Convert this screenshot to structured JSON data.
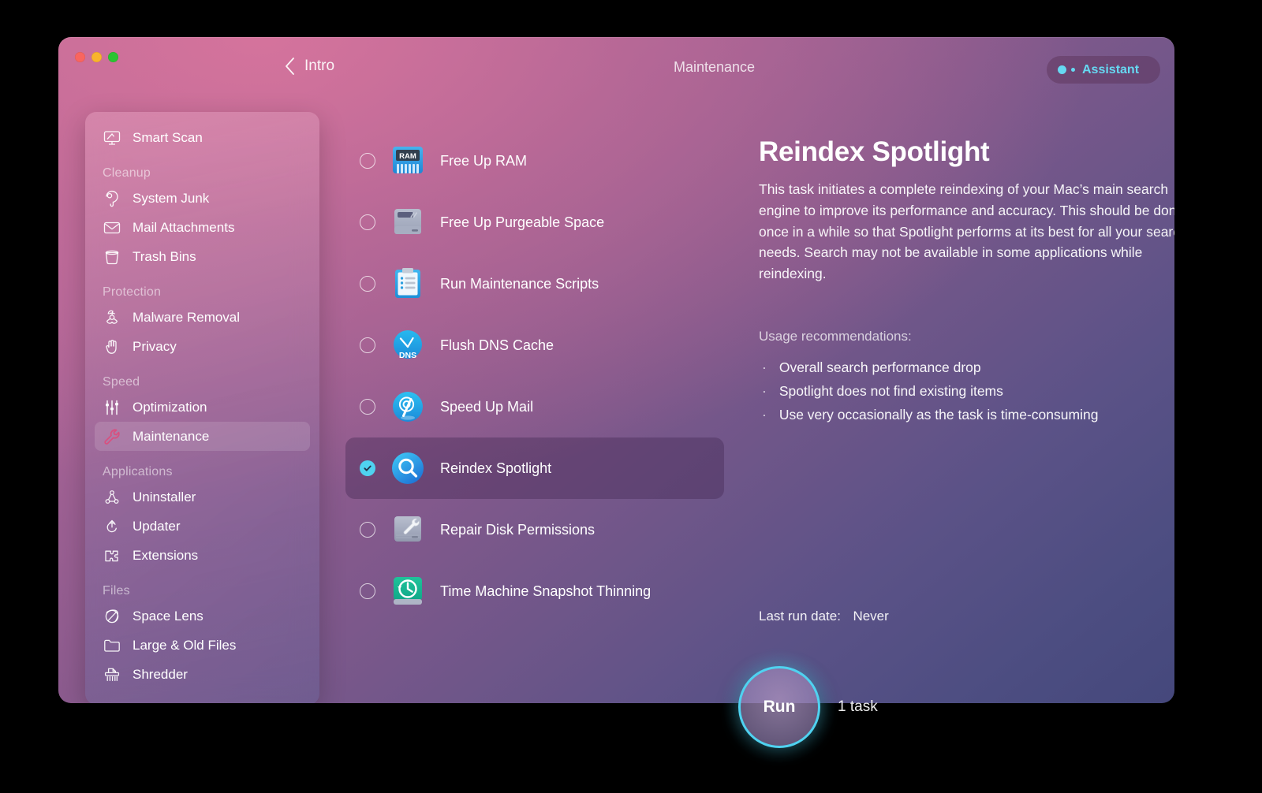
{
  "window": {
    "traffic_lights": [
      "close",
      "minimize",
      "zoom"
    ],
    "colors": {
      "accent_cyan": "#4fd2f0",
      "gradient_start": "#c46d97",
      "gradient_end": "#45487c",
      "selected_row": "rgba(68,41,83,0.40)"
    }
  },
  "topbar": {
    "back_label": "Intro",
    "breadcrumb_title": "Maintenance",
    "assistant_label": "Assistant"
  },
  "sidebar": {
    "groups": [
      {
        "title": "",
        "items": [
          {
            "label": "Smart Scan",
            "icon": "smart-scan-icon",
            "active": false
          }
        ]
      },
      {
        "title": "Cleanup",
        "items": [
          {
            "label": "System Junk",
            "icon": "system-junk-icon",
            "active": false
          },
          {
            "label": "Mail Attachments",
            "icon": "mail-icon",
            "active": false
          },
          {
            "label": "Trash Bins",
            "icon": "trash-bin-icon",
            "active": false
          }
        ]
      },
      {
        "title": "Protection",
        "items": [
          {
            "label": "Malware Removal",
            "icon": "biohazard-icon",
            "active": false
          },
          {
            "label": "Privacy",
            "icon": "hand-icon",
            "active": false
          }
        ]
      },
      {
        "title": "Speed",
        "items": [
          {
            "label": "Optimization",
            "icon": "sliders-icon",
            "active": false
          },
          {
            "label": "Maintenance",
            "icon": "wrench-icon",
            "active": true
          }
        ]
      },
      {
        "title": "Applications",
        "items": [
          {
            "label": "Uninstaller",
            "icon": "uninstaller-icon",
            "active": false
          },
          {
            "label": "Updater",
            "icon": "updater-icon",
            "active": false
          },
          {
            "label": "Extensions",
            "icon": "puzzle-icon",
            "active": false
          }
        ]
      },
      {
        "title": "Files",
        "items": [
          {
            "label": "Space Lens",
            "icon": "space-lens-icon",
            "active": false
          },
          {
            "label": "Large & Old Files",
            "icon": "folder-icon",
            "active": false
          },
          {
            "label": "Shredder",
            "icon": "shredder-icon",
            "active": false
          }
        ]
      }
    ]
  },
  "tasks": [
    {
      "label": "Free Up RAM",
      "icon": "ram-chip-icon",
      "checked": false,
      "selected": false
    },
    {
      "label": "Free Up Purgeable Space",
      "icon": "hard-drive-icon",
      "checked": false,
      "selected": false
    },
    {
      "label": "Run Maintenance Scripts",
      "icon": "clipboard-icon",
      "checked": false,
      "selected": false
    },
    {
      "label": "Flush DNS Cache",
      "icon": "dns-icon",
      "checked": false,
      "selected": false
    },
    {
      "label": "Speed Up Mail",
      "icon": "mail-speed-icon",
      "checked": false,
      "selected": false
    },
    {
      "label": "Reindex Spotlight",
      "icon": "spotlight-search-icon",
      "checked": true,
      "selected": true
    },
    {
      "label": "Repair Disk Permissions",
      "icon": "disk-wrench-icon",
      "checked": false,
      "selected": false
    },
    {
      "label": "Time Machine Snapshot Thinning",
      "icon": "time-machine-icon",
      "checked": false,
      "selected": false
    }
  ],
  "detail": {
    "title": "Reindex Spotlight",
    "description": "This task initiates a complete reindexing of your Mac’s main search engine to improve its performance and accuracy. This should be done once in a while so that Spotlight performs at its best for all your search needs. Search may not be available in some applications while reindexing.",
    "recommendations_title": "Usage recommendations:",
    "recommendations": [
      "Overall search performance drop",
      "Spotlight does not find existing items",
      "Use very occasionally as the task is time-consuming"
    ],
    "bullet": "·",
    "last_run_label": "Last run date:",
    "last_run_value": "Never"
  },
  "footer": {
    "run_label": "Run",
    "task_count": "1 task"
  }
}
